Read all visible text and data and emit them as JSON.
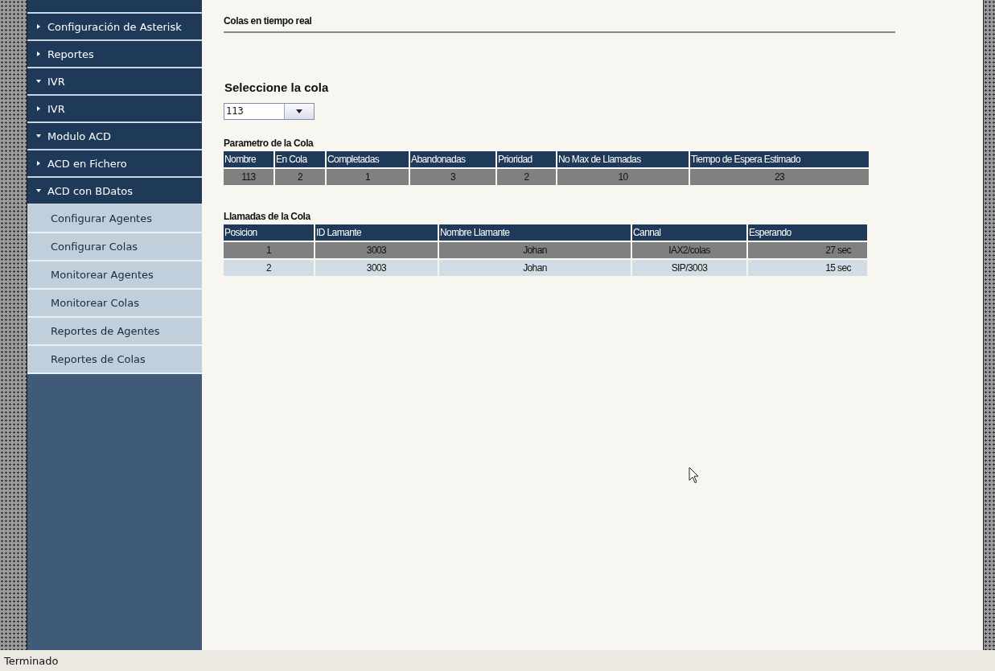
{
  "sidebar": {
    "items": [
      {
        "kind": "section",
        "label": "Configuración de Asterisk",
        "expanded": false
      },
      {
        "kind": "section",
        "label": "Reportes",
        "expanded": false
      },
      {
        "kind": "section",
        "label": "IVR",
        "expanded": true
      },
      {
        "kind": "section",
        "label": "IVR",
        "expanded": false
      },
      {
        "kind": "section",
        "label": "Modulo ACD",
        "expanded": true
      },
      {
        "kind": "section",
        "label": "ACD en Fichero",
        "expanded": false
      },
      {
        "kind": "section",
        "label": "ACD con BDatos",
        "expanded": true
      },
      {
        "kind": "link",
        "label": "Configurar Agentes"
      },
      {
        "kind": "link",
        "label": "Configurar Colas"
      },
      {
        "kind": "link",
        "label": "Monitorear Agentes"
      },
      {
        "kind": "link",
        "label": "Monitorear Colas"
      },
      {
        "kind": "link",
        "label": "Reportes de Agentes"
      },
      {
        "kind": "link",
        "label": "Reportes de Colas"
      }
    ]
  },
  "page_title": "Colas en tiempo real",
  "queue_select": {
    "label": "Seleccione la cola",
    "value": "113"
  },
  "params": {
    "title": "Parametro de la Cola",
    "columns": [
      "Nombre",
      "En Cola",
      "Completadas",
      "Abandonadas",
      "Prioridad",
      "No Max de Llamadas",
      "Tiempo de Espera Estimado"
    ],
    "rows": [
      [
        "113",
        "2",
        "1",
        "3",
        "2",
        "10",
        "23"
      ]
    ]
  },
  "calls": {
    "title": "Llamadas de la Cola",
    "columns": [
      "Posicion",
      "ID Lamante",
      "Nombre Llamante",
      "Cannal",
      "Esperando"
    ],
    "rows": [
      [
        "1",
        "3003",
        "Johan",
        "IAX2/colas",
        "27 sec"
      ],
      [
        "2",
        "3003",
        "Johan",
        "SIP/3003",
        "15 sec"
      ]
    ]
  },
  "status_bar": {
    "text": "Terminado"
  }
}
